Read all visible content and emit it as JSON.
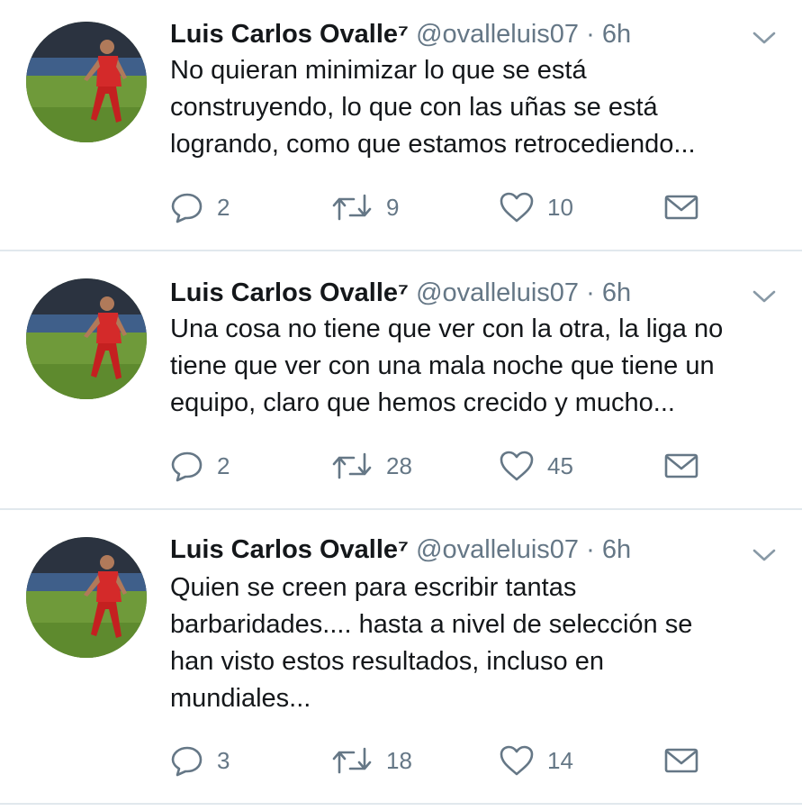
{
  "tweets": [
    {
      "name": "Luis Carlos Ovalle⁷",
      "handle": "@ovalleluis07",
      "separator": "·",
      "time": "6h",
      "lines": [
        "No quieran minimizar lo que se está",
        "construyendo, lo que con las uñas se está",
        "logrando, como que estamos retrocediendo..."
      ],
      "replies": "2",
      "retweets": "9",
      "likes": "10"
    },
    {
      "name": "Luis Carlos Ovalle⁷",
      "handle": "@ovalleluis07",
      "separator": "·",
      "time": "6h",
      "lines": [
        "Una cosa no tiene que ver con la otra, la liga no",
        "tiene que ver con una mala noche que tiene un",
        "equipo, claro que hemos crecido y mucho..."
      ],
      "replies": "2",
      "retweets": "28",
      "likes": "45"
    },
    {
      "name": "Luis Carlos Ovalle⁷",
      "handle": "@ovalleluis07",
      "separator": "·",
      "time": "6h",
      "lines": [
        "Quien se creen para escribir tantas",
        "barbaridades.... hasta a nivel de selección se",
        "han visto estos resultados, incluso en",
        "mundiales..."
      ],
      "replies": "3",
      "retweets": "18",
      "likes": "14"
    }
  ],
  "icons": {
    "reply": "reply-icon",
    "retweet": "retweet-icon",
    "like": "heart-icon",
    "dm": "envelope-icon",
    "menu": "chevron-down-icon"
  },
  "colors": {
    "text": "#14171a",
    "secondary": "#657786",
    "divider": "#e1e8ed",
    "background": "#ffffff"
  }
}
